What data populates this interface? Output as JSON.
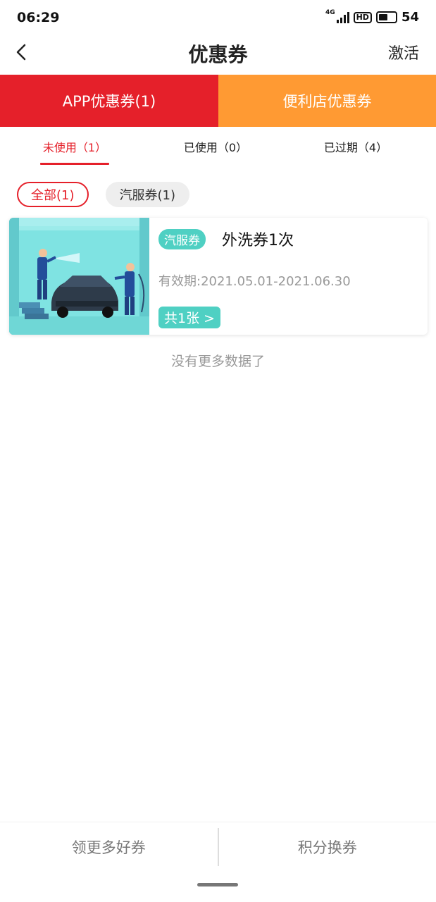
{
  "status": {
    "time": "06:29",
    "network": "4G",
    "battery": "54"
  },
  "header": {
    "title": "优惠券",
    "activate_label": "激活"
  },
  "main_tabs": [
    {
      "label": "APP优惠券(1)",
      "color": "#e5202a"
    },
    {
      "label": "便利店优惠券",
      "color": "#ff9a33"
    }
  ],
  "sub_tabs": [
    {
      "label": "未使用（1）"
    },
    {
      "label": "已使用（0）"
    },
    {
      "label": "已过期（4）"
    }
  ],
  "filters": [
    {
      "label": "全部(1)"
    },
    {
      "label": "汽服券(1)"
    }
  ],
  "coupon": {
    "tag": "汽服券",
    "name": "外洗券1次",
    "validity": "有效期:2021.05.01-2021.06.30",
    "count": "共1张 >",
    "accent_color": "#4fd0c3"
  },
  "empty_text": "没有更多数据了",
  "bottom": {
    "left_label": "领更多好券",
    "right_label": "积分换券"
  }
}
